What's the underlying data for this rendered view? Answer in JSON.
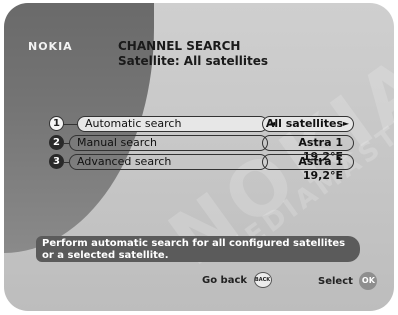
{
  "brand": "NOKIA",
  "header": {
    "title": "CHANNEL SEARCH",
    "subtitle": "Satellite: All satellites"
  },
  "watermark": {
    "line1": "NOKIA",
    "line2": "MEDIAMASTER"
  },
  "menu": [
    {
      "number": "1",
      "label": "Automatic search",
      "value": "All satellites",
      "selected": true
    },
    {
      "number": "2",
      "label": "Manual search",
      "value": "Astra 1 19,2°E",
      "selected": false
    },
    {
      "number": "3",
      "label": "Advanced search",
      "value": "Astra 1 19,2°E",
      "selected": false
    }
  ],
  "help_text": "Perform automatic search for all configured satellites or a selected satellite.",
  "footer": {
    "back_label": "Go back",
    "back_key": "BACK",
    "select_label": "Select",
    "select_key": "OK"
  }
}
